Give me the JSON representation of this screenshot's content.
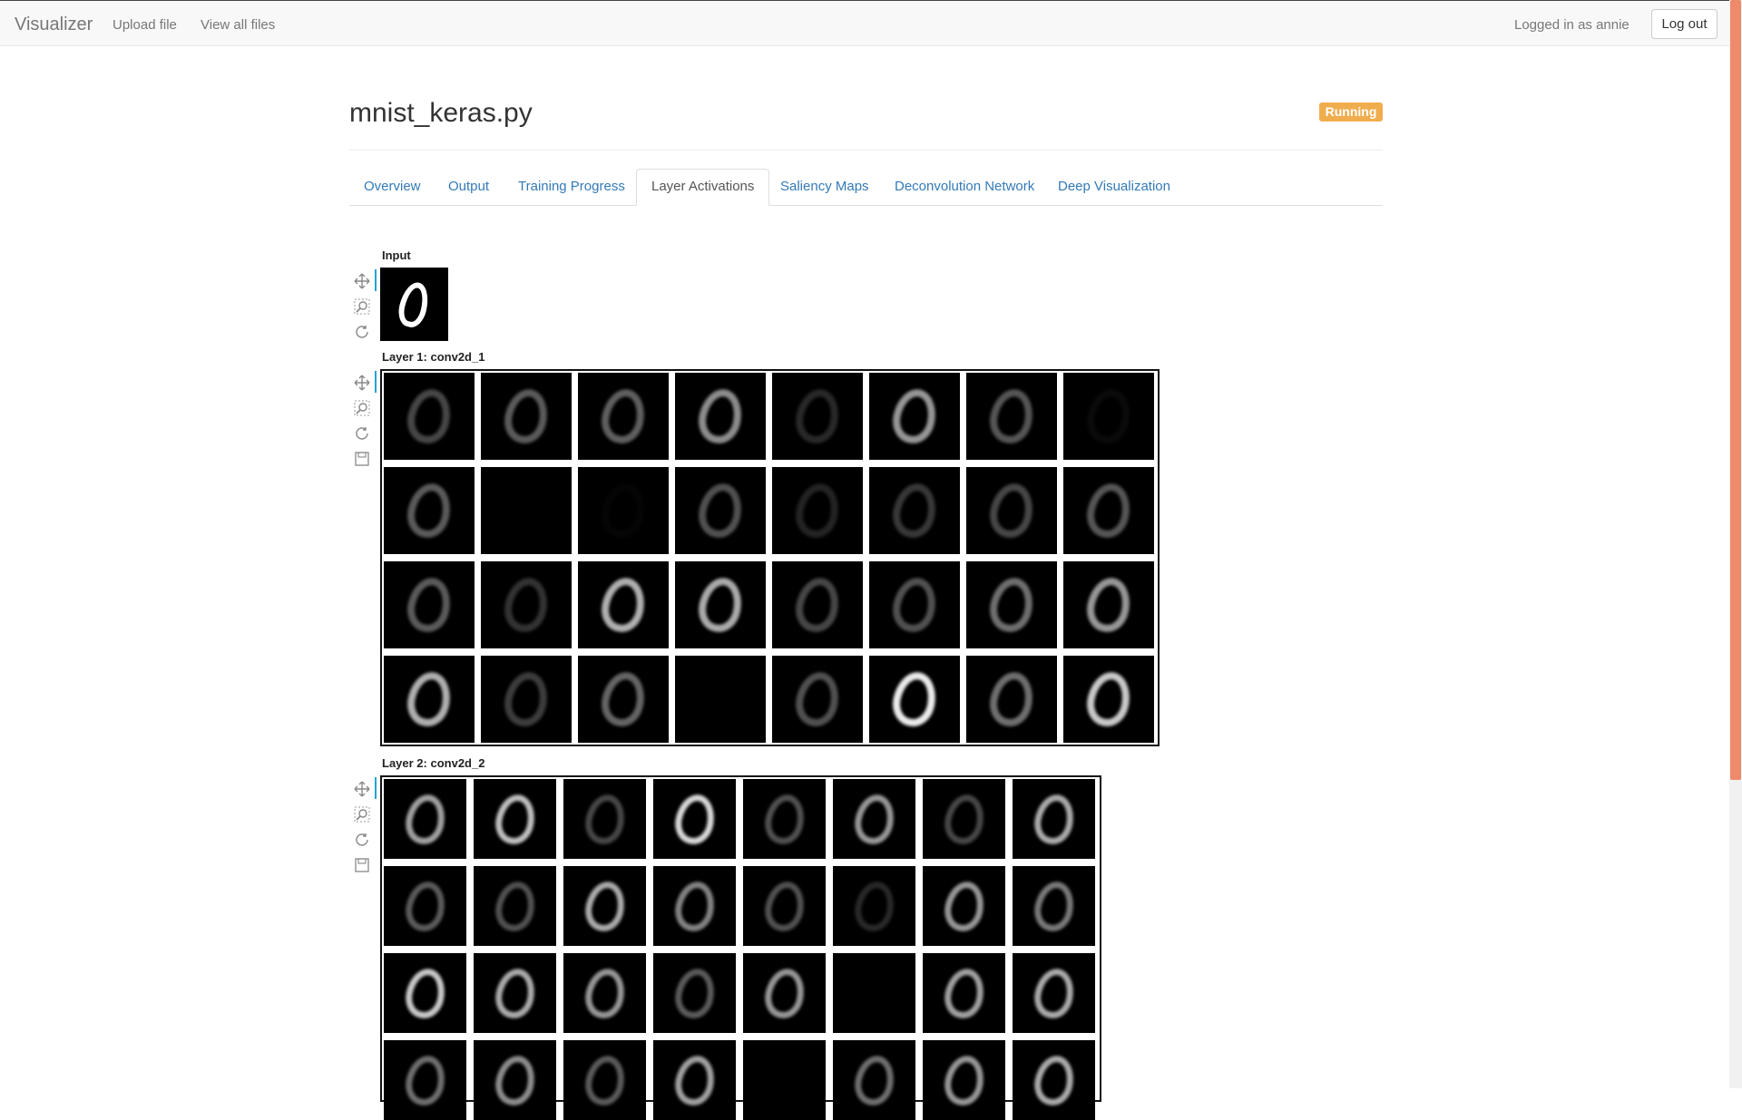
{
  "navbar": {
    "brand": "Visualizer",
    "links": [
      "Upload file",
      "View all files"
    ],
    "user_text": "Logged in as annie",
    "logout_label": "Log out"
  },
  "header": {
    "title": "mnist_keras.py",
    "status": "Running"
  },
  "tabs": [
    {
      "label": "Overview",
      "active": false
    },
    {
      "label": "Output",
      "active": false
    },
    {
      "label": "Training Progress",
      "active": false
    },
    {
      "label": "Layer Activations",
      "active": true
    },
    {
      "label": "Saliency Maps",
      "active": false
    },
    {
      "label": "Deconvolution Network",
      "active": false
    },
    {
      "label": "Deep Visualization",
      "active": false
    }
  ],
  "layers": [
    {
      "label": "Input"
    },
    {
      "label": "Layer 1: conv2d_1"
    },
    {
      "label": "Layer 2: conv2d_2"
    }
  ],
  "toolbar_icons": [
    "pan-icon",
    "box-zoom-icon",
    "reset-icon",
    "save-icon"
  ],
  "colors": {
    "accent": "#337ab7",
    "status": "#f0ad4e",
    "scroll_thumb": "#ef8a6b"
  }
}
